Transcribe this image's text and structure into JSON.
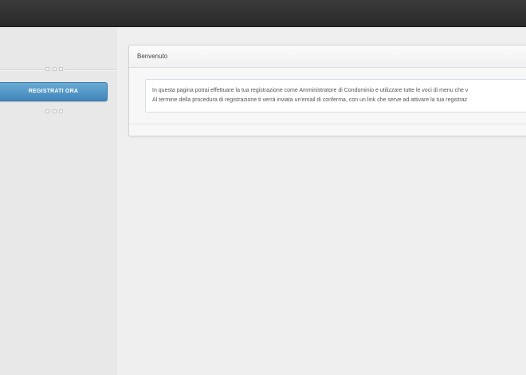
{
  "sidebar": {
    "register_button": "REGISTRATI ORA"
  },
  "panel": {
    "title": "Benvenuto",
    "lines": [
      "In questa pagina potrai effettuare la tua registrazione come Amministratore di Condominio e utilizzare tutte le voci di menu che v",
      "Al termine della procedura di registrazione ti verrà inviata un'email di conferma, con un link che serve ad attivare la tua registraz"
    ]
  },
  "colors": {
    "topbar": "#2f2f2f",
    "button": "#4a90c4",
    "background": "#ededed"
  }
}
